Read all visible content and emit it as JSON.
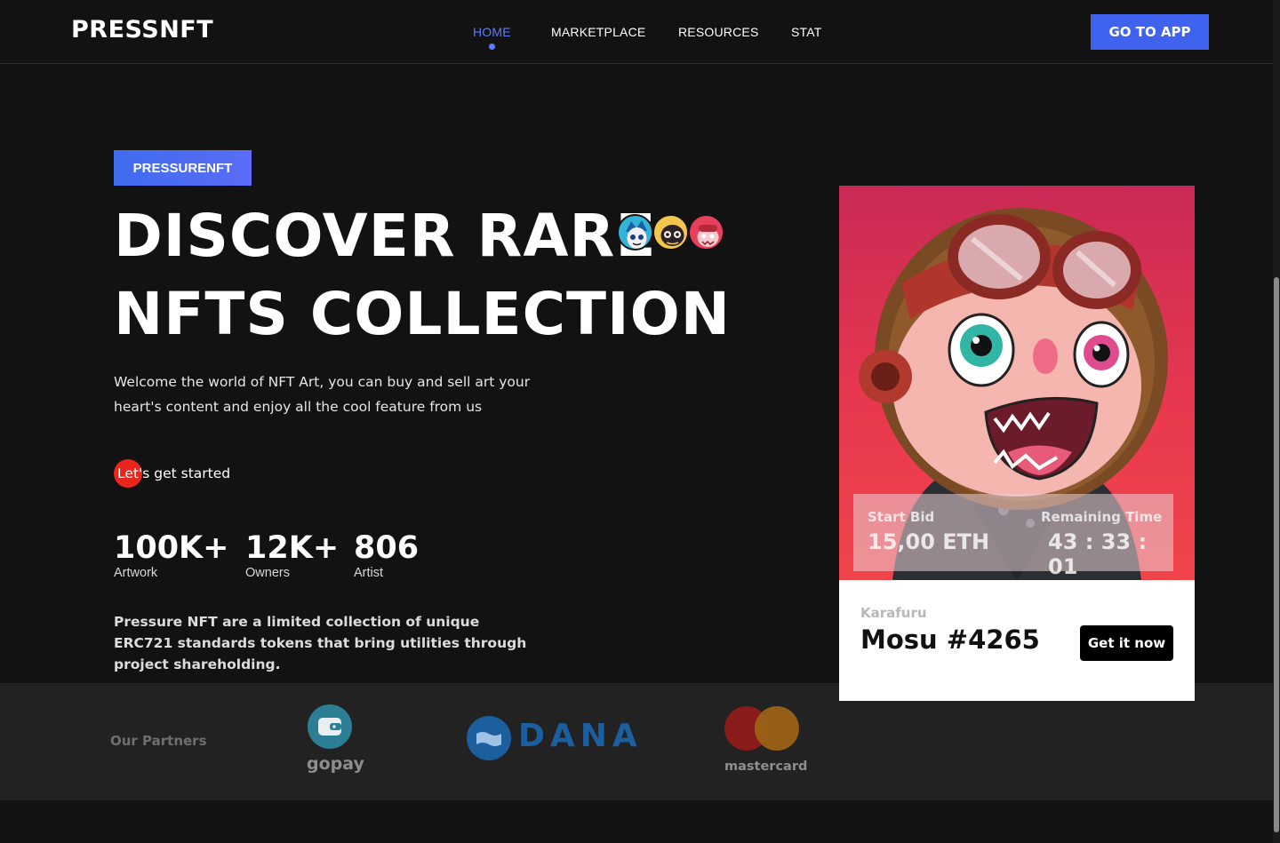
{
  "navbar": {
    "logo": "PRESSNFT",
    "links": [
      {
        "label": "HOME",
        "active": true
      },
      {
        "label": "MARKETPLACE",
        "active": false
      },
      {
        "label": "RESOURCES",
        "active": false
      },
      {
        "label": "STAT",
        "active": false
      }
    ],
    "cta_label": "GO TO APP"
  },
  "hero": {
    "badge": "PRESSURENFT",
    "title_line1": "DISCOVER RARE",
    "title_line2": "NFTS COLLECTION",
    "subtitle": "Welcome the world of NFT Art, you can buy and sell art your heart's content and enjoy all the cool feature from us",
    "cta_highlight": "Let'",
    "cta_rest": "s get started",
    "stats": [
      {
        "value": "100K+",
        "label": "Artwork"
      },
      {
        "value": "12K+",
        "label": "Owners"
      },
      {
        "value": "806",
        "label": "Artist"
      }
    ],
    "about": "Pressure NFT are a limited collection of unique ERC721 standards tokens that bring utilities through project shareholding."
  },
  "partners": {
    "label": "Our Partners",
    "items": [
      {
        "name": "gopay",
        "icon": "wallet-icon",
        "color": "#2b7e94"
      },
      {
        "name": "DANA",
        "icon": "dana-logo-icon",
        "color": "#1c5f9f"
      },
      {
        "name": "mastercard",
        "icon": "mastercard-logo-icon",
        "color": "#8a1b1b"
      }
    ]
  },
  "card": {
    "start_bid_label": "Start Bid",
    "start_bid_value": "15,00 ETH",
    "remaining_label": "Remaining Time",
    "remaining_value": "43 : 33 : 01",
    "collection": "Karafuru",
    "name": "Mosu #4265",
    "cta_label": "Get it now"
  },
  "colors": {
    "accent": "#3f63ef",
    "background": "#131213",
    "partners_bg": "#222223",
    "highlight_red": "#e8261c"
  }
}
